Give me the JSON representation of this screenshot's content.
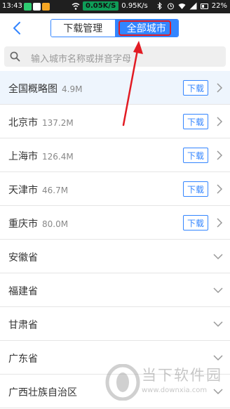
{
  "status_bar": {
    "time": "13:43",
    "speed_primary": "0.05K/S",
    "speed_secondary": "0.95K/s",
    "battery": "22%"
  },
  "header": {
    "tabs": [
      {
        "label": "下载管理",
        "active": false
      },
      {
        "label": "全部城市",
        "active": true
      }
    ]
  },
  "search": {
    "placeholder": "输入城市名称或拼音字母"
  },
  "list": {
    "items": [
      {
        "name": "全国概略图",
        "size": "4.9M",
        "action": "下载"
      },
      {
        "name": "北京市",
        "size": "137.2M",
        "action": "下载"
      },
      {
        "name": "上海市",
        "size": "126.4M",
        "action": "下载"
      },
      {
        "name": "天津市",
        "size": "46.7M",
        "action": "下载"
      },
      {
        "name": "重庆市",
        "size": "80.0M",
        "action": "下载"
      },
      {
        "name": "安徽省"
      },
      {
        "name": "福建省"
      },
      {
        "name": "甘肃省"
      },
      {
        "name": "广东省"
      },
      {
        "name": "广西壮族自治区"
      }
    ]
  },
  "watermark": {
    "title": "当下软件园",
    "url": "www.downxia.com"
  },
  "colors": {
    "accent": "#3385ff",
    "highlight_row": "#eef5fd",
    "annotation": "#e21b23",
    "status_bar": "#1f1f1f"
  }
}
